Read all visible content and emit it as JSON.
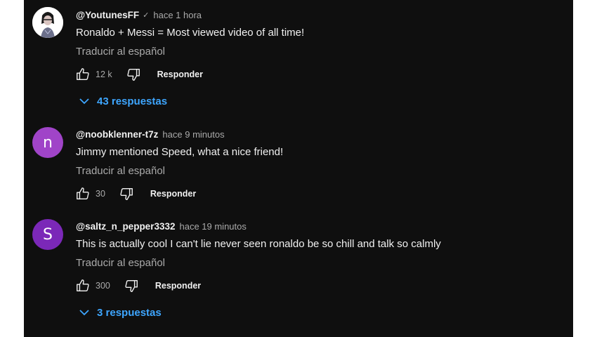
{
  "comments": [
    {
      "author": "@YoutunesFF",
      "verified": true,
      "time": "hace 1 hora",
      "text": "Ronaldo + Messi = Most viewed video of all time!",
      "translate": "Traducir al español",
      "likes": "12 k",
      "reply": "Responder",
      "replies": "43 respuestas"
    },
    {
      "author": "@noobklenner-t7z",
      "avatar_letter": "n",
      "avatar_color": "#a044c8",
      "time": "hace 9 minutos",
      "text": "Jimmy mentioned Speed, what a nice friend!",
      "translate": "Traducir al español",
      "likes": "30",
      "reply": "Responder"
    },
    {
      "author": "@saltz_n_pepper3332",
      "avatar_letter": "S",
      "avatar_color": "#7b28b8",
      "time": "hace 19 minutos",
      "text": "This is actually cool I can't lie never seen ronaldo be so chill and talk so calmly",
      "translate": "Traducir al español",
      "likes": "300",
      "reply": "Responder",
      "replies": "3 respuestas"
    }
  ]
}
